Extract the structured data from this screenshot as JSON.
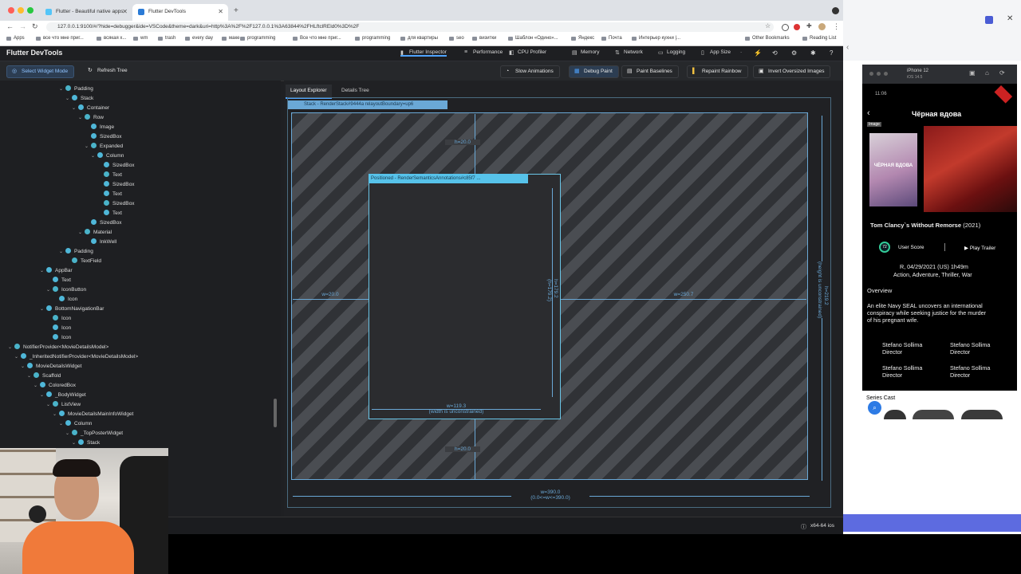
{
  "browser": {
    "tabs": [
      {
        "title": "Flutter - Beautiful native apps"
      },
      {
        "title": "Flutter DevTools"
      }
    ],
    "url": "127.0.0.1:9100/#/?hide=debugger&ide=VSCode&theme=dark&uri=http%3A%2F%2F127.0.0.1%3A63844%2FHLftclREld0%3D%2F",
    "bookmarks": [
      "Apps",
      "все что мне приг...",
      "всякая х...",
      "wm",
      "trash",
      "every day",
      "маке",
      "programming",
      "Все что мне приг...",
      "programming",
      "для квартиры",
      "seo",
      "визитки",
      "Шаблон «Одино»...",
      "Яндекс",
      "Почта",
      "Интерьер кухни |...",
      "Other Bookmarks",
      "Reading List"
    ]
  },
  "devtools": {
    "title": "Flutter DevTools",
    "tabs": [
      "Flutter Inspector",
      "Performance",
      "CPU Profiler",
      "Memory",
      "Network",
      "Logging",
      "App Size"
    ],
    "toolbar": {
      "select_mode": "Select Widget Mode",
      "refresh": "Refresh Tree",
      "slow_animations": "Slow Animations",
      "debug_paint": "Debug Paint",
      "paint_baselines": "Paint Baselines",
      "repaint_rainbow": "Repaint Rainbow",
      "invert_images": "Invert Oversized Images"
    },
    "tree": [
      {
        "label": "Padding"
      },
      {
        "label": "Stack"
      },
      {
        "label": "Container"
      },
      {
        "label": "Row"
      },
      {
        "label": "Image"
      },
      {
        "label": "SizedBox"
      },
      {
        "label": "Expanded"
      },
      {
        "label": "Column"
      },
      {
        "label": "SizedBox"
      },
      {
        "label": "Text"
      },
      {
        "label": "SizedBox"
      },
      {
        "label": "Text"
      },
      {
        "label": "SizedBox"
      },
      {
        "label": "Text"
      },
      {
        "label": "SizedBox"
      },
      {
        "label": "Material"
      },
      {
        "label": "InkWell"
      },
      {
        "label": "Padding"
      },
      {
        "label": "TextField"
      },
      {
        "label": "AppBar"
      },
      {
        "label": "Text"
      },
      {
        "label": "IconButton"
      },
      {
        "label": "Icon"
      },
      {
        "label": "BottomNavigationBar"
      },
      {
        "label": "Icon"
      },
      {
        "label": "Icon"
      },
      {
        "label": "Icon"
      },
      {
        "label": "NotifierProvider<MovieDetailsModel>"
      },
      {
        "label": "_InheritedNotifierProvider<MovieDetailsModel>"
      },
      {
        "label": "MovieDetailsWidget"
      },
      {
        "label": "Scaffold"
      },
      {
        "label": "ColoredBox"
      },
      {
        "label": "_BodyWidget"
      },
      {
        "label": "ListView"
      },
      {
        "label": "MovieDetailsMainInfoWidget"
      },
      {
        "label": "Column"
      },
      {
        "label": "_TopPosterWidget"
      },
      {
        "label": "Stack"
      }
    ],
    "panel_tabs": [
      "Layout Explorer",
      "Details Tree"
    ],
    "layout": {
      "stack_label": "Stack - RenderStack#9444a relayoutBoundary=up6",
      "child_label": "Positioned - RenderSemanticsAnnotations#c85f7 ...",
      "top": "h=20.0",
      "bottom": "h=20.0",
      "left": "w=20.0",
      "right": "w=250.7",
      "child_height": "h=179.2",
      "child_height2": "(h=179.2)",
      "child_width": "w=119.3",
      "child_width_note": "(width is unconstrained)",
      "total_width": "w=390.0",
      "total_width_note": "(0.0<=w<=390.0)",
      "total_height": "h=219.2",
      "total_height_note": "(height is unconstrained)"
    },
    "status": "x64-64 ios"
  },
  "simulator": {
    "device": "iPhone 12",
    "os": "iOS 14.5",
    "time": "11:06",
    "screen_title": "Чёрная вдова",
    "image_label": "Image",
    "movie": "Tom Clancy`s Without Remorse",
    "year": "(2021)",
    "score": "72",
    "user_score": "User Score",
    "play_trailer": "Play Trailer",
    "release": "R, 04/29/2021 (US) 1h49m",
    "genres": "Action, Adventure, Thriller, War",
    "overview_title": "Overview",
    "overview": [
      "An elite Navy SEAL uncovers an international",
      "conspiracy while seeking justice for the murder",
      "of his pregnant wife."
    ],
    "crew": [
      {
        "name": "Stefano Sollima",
        "role": "Director"
      },
      {
        "name": "Stefano Sollima",
        "role": "Director"
      },
      {
        "name": "Stefano Sollima",
        "role": "Director"
      },
      {
        "name": "Stefano Sollima",
        "role": "Director"
      }
    ],
    "cast_title": "Series Cast",
    "poster_text": "ЧЁРНАЯ ВДОВА"
  }
}
